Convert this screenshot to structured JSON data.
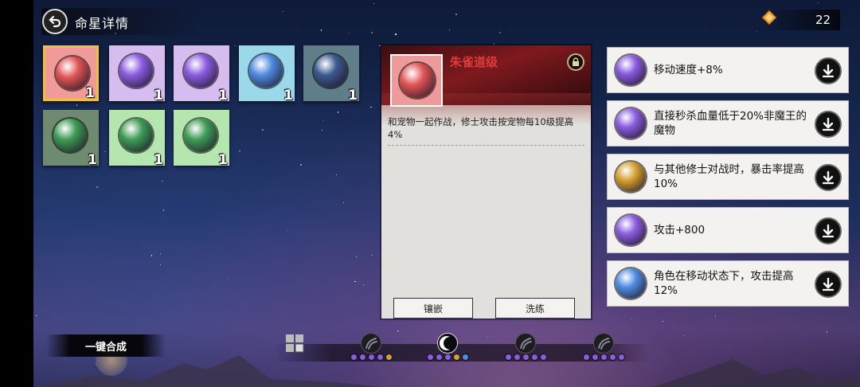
{
  "header": {
    "title": "命星详情",
    "currency_value": "22"
  },
  "colors": {
    "red": "#e05555",
    "purple": "#8a5ce0",
    "blue": "#4f8be0",
    "teal_blue": "#3c5a90",
    "green": "#3e9b55",
    "gold": "#d4a030",
    "accent_gold": "#f0c040"
  },
  "slots": [
    {
      "color": "red",
      "bg": "#f09a9a",
      "count": "1",
      "selected": true
    },
    {
      "color": "purple",
      "bg": "#d7bcf0",
      "count": "1"
    },
    {
      "color": "purple",
      "bg": "#d7bcf0",
      "count": "1"
    },
    {
      "color": "blue",
      "bg": "#9ad8ea",
      "count": "1"
    },
    {
      "color": "teal_blue",
      "bg": "#5f7e8a",
      "count": "1"
    },
    {
      "color": "green",
      "bg": "#6f8b6f",
      "count": "1"
    },
    {
      "color": "green",
      "bg": "#b6e6b0",
      "count": "1"
    },
    {
      "color": "green",
      "bg": "#b6e6b0",
      "count": "1"
    }
  ],
  "detail": {
    "name": "朱雀道级",
    "description": "和宠物一起作战，修士攻击按宠物每10级提高4%",
    "inlay_label": "镶嵌",
    "refine_label": "洗练"
  },
  "attributes": [
    {
      "text": "移动速度+8%",
      "color": "purple"
    },
    {
      "text": "直接秒杀血量低于20%非魔王的魔物",
      "color": "purple"
    },
    {
      "text": "与其他修士对战时，暴击率提高10%",
      "color": "gold"
    },
    {
      "text": "攻击+800",
      "color": "purple"
    },
    {
      "text": "角色在移动状态下，攻击提高12%",
      "color": "blue"
    }
  ],
  "bottom": {
    "combine_label": "一键合成",
    "tabs": [
      {
        "icon": "grid-icon",
        "dots": []
      },
      {
        "icon": "claw-icon",
        "dots": [
          "purple",
          "purple",
          "purple",
          "purple",
          "gold"
        ]
      },
      {
        "icon": "moon-icon",
        "dots": [
          "purple",
          "purple",
          "purple",
          "gold",
          "blue"
        ],
        "active": true
      },
      {
        "icon": "scratch-icon",
        "dots": [
          "purple",
          "purple",
          "purple",
          "purple",
          "purple"
        ]
      },
      {
        "icon": "shell-icon",
        "dots": [
          "purple",
          "purple",
          "purple",
          "purple",
          "purple"
        ]
      }
    ]
  }
}
